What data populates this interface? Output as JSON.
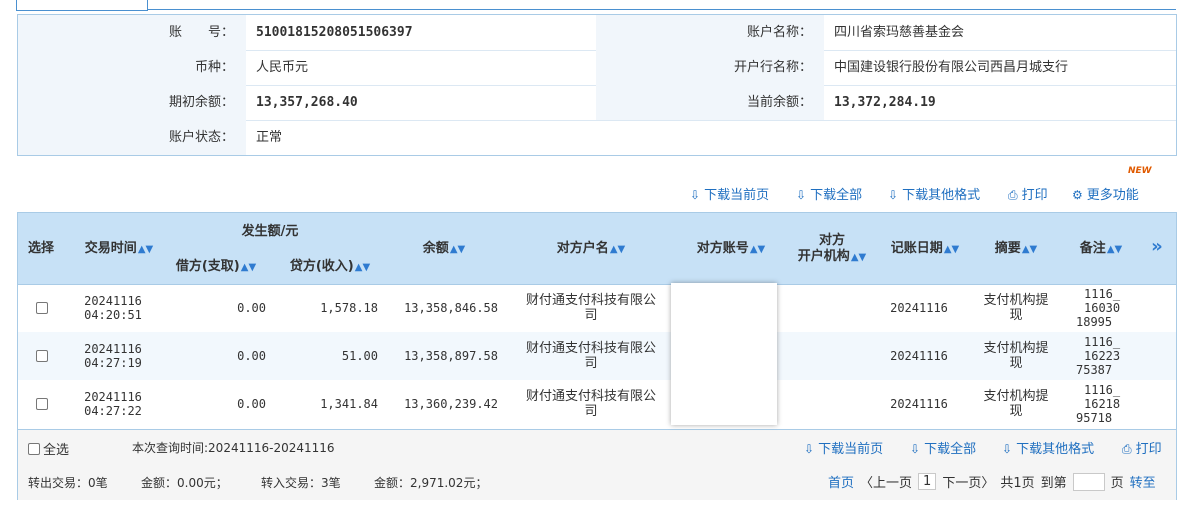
{
  "account": {
    "rows": [
      {
        "label1": "账　　号：",
        "value1": "51001815208051506397",
        "label2": "账户名称：",
        "value2": "四川省索玛慈善基金会"
      },
      {
        "label1": "币种：",
        "value1": "人民币元",
        "label2": "开户行名称：",
        "value2": "中国建设银行股份有限公司西昌月城支行"
      },
      {
        "label1": "期初余额：",
        "value1": "13,357,268.40",
        "label2": "当前余额：",
        "value2": "13,372,284.19"
      },
      {
        "label1": "账户状态：",
        "value1": "正常"
      }
    ]
  },
  "toolbar": {
    "new_badge": "NEW",
    "download_current": "下载当前页",
    "download_all": "下载全部",
    "download_other": "下载其他格式",
    "print": "打印",
    "more": "更多功能"
  },
  "table": {
    "headers": {
      "select": "选择",
      "time": "交易时间",
      "amount_group": "发生额/元",
      "debit": "借方(支取)",
      "credit": "贷方(收入)",
      "balance": "余额",
      "counter_name": "对方户名",
      "counter_account": "对方账号",
      "counter_bank_1": "对方",
      "counter_bank_2": "开户机构",
      "post_date": "记账日期",
      "summary": "摘要",
      "remark": "备注",
      "expand": "»"
    },
    "rows": [
      {
        "date": "20241116",
        "time": "04:20:51",
        "debit": "0.00",
        "credit": "1,578.18",
        "balance": "13,358,846.58",
        "name1": "财付通支付科技有限公",
        "name2": "司",
        "post": "20241116",
        "sum1": "支付机构提",
        "sum2": "现",
        "r1": "1116_",
        "r2": "16030",
        "r3": "18995"
      },
      {
        "date": "20241116",
        "time": "04:27:19",
        "debit": "0.00",
        "credit": "51.00",
        "balance": "13,358,897.58",
        "name1": "财付通支付科技有限公",
        "name2": "司",
        "post": "20241116",
        "sum1": "支付机构提",
        "sum2": "现",
        "r1": "1116_",
        "r2": "16223",
        "r3": "75387"
      },
      {
        "date": "20241116",
        "time": "04:27:22",
        "debit": "0.00",
        "credit": "1,341.84",
        "balance": "13,360,239.42",
        "name1": "财付通支付科技有限公",
        "name2": "司",
        "post": "20241116",
        "sum1": "支付机构提",
        "sum2": "现",
        "r1": "1116_",
        "r2": "16218",
        "r3": "95718"
      }
    ]
  },
  "footer": {
    "select_all": "全选",
    "query_time": "本次查询时间:20241116-20241116",
    "download_current": "下载当前页",
    "download_all": "下载全部",
    "download_other": "下载其他格式",
    "print": "打印",
    "out_count": "转出交易：0笔",
    "out_amount": "金额：0.00元；",
    "in_count": "转入交易：3笔",
    "in_amount": "金额：2,971.02元；",
    "pager": {
      "first": "首页",
      "prev": "〈上一页",
      "current": "1",
      "next": "下一页〉",
      "total": "共1页",
      "goto_prefix": "到第",
      "goto_suffix": "页",
      "go": "转至"
    }
  }
}
